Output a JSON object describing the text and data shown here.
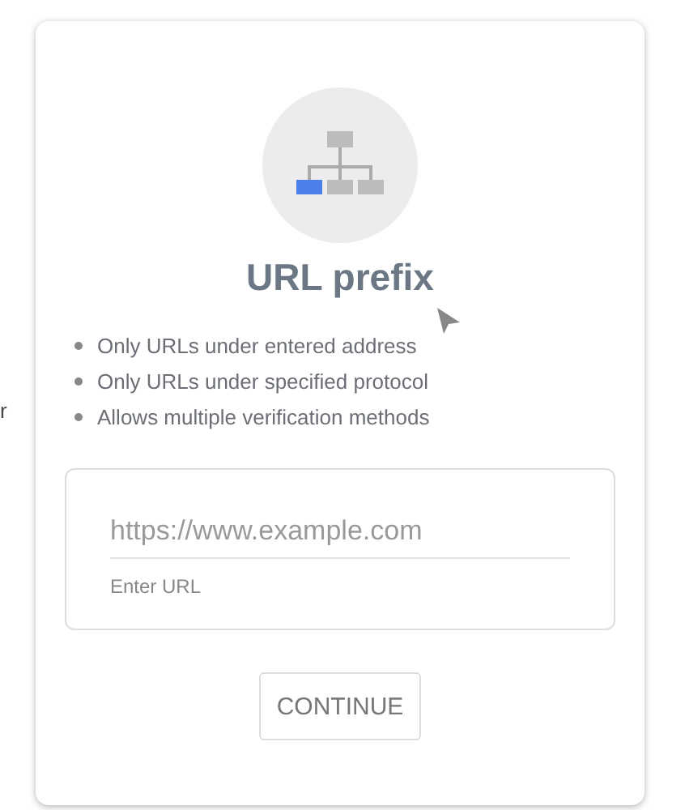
{
  "background_text": "r",
  "card": {
    "title": "URL prefix",
    "features": [
      "Only URLs under entered address",
      "Only URLs under specified protocol",
      "Allows multiple verification methods"
    ],
    "url_field": {
      "placeholder": "https://www.example.com",
      "helper": "Enter URL"
    },
    "button": "CONTINUE"
  }
}
